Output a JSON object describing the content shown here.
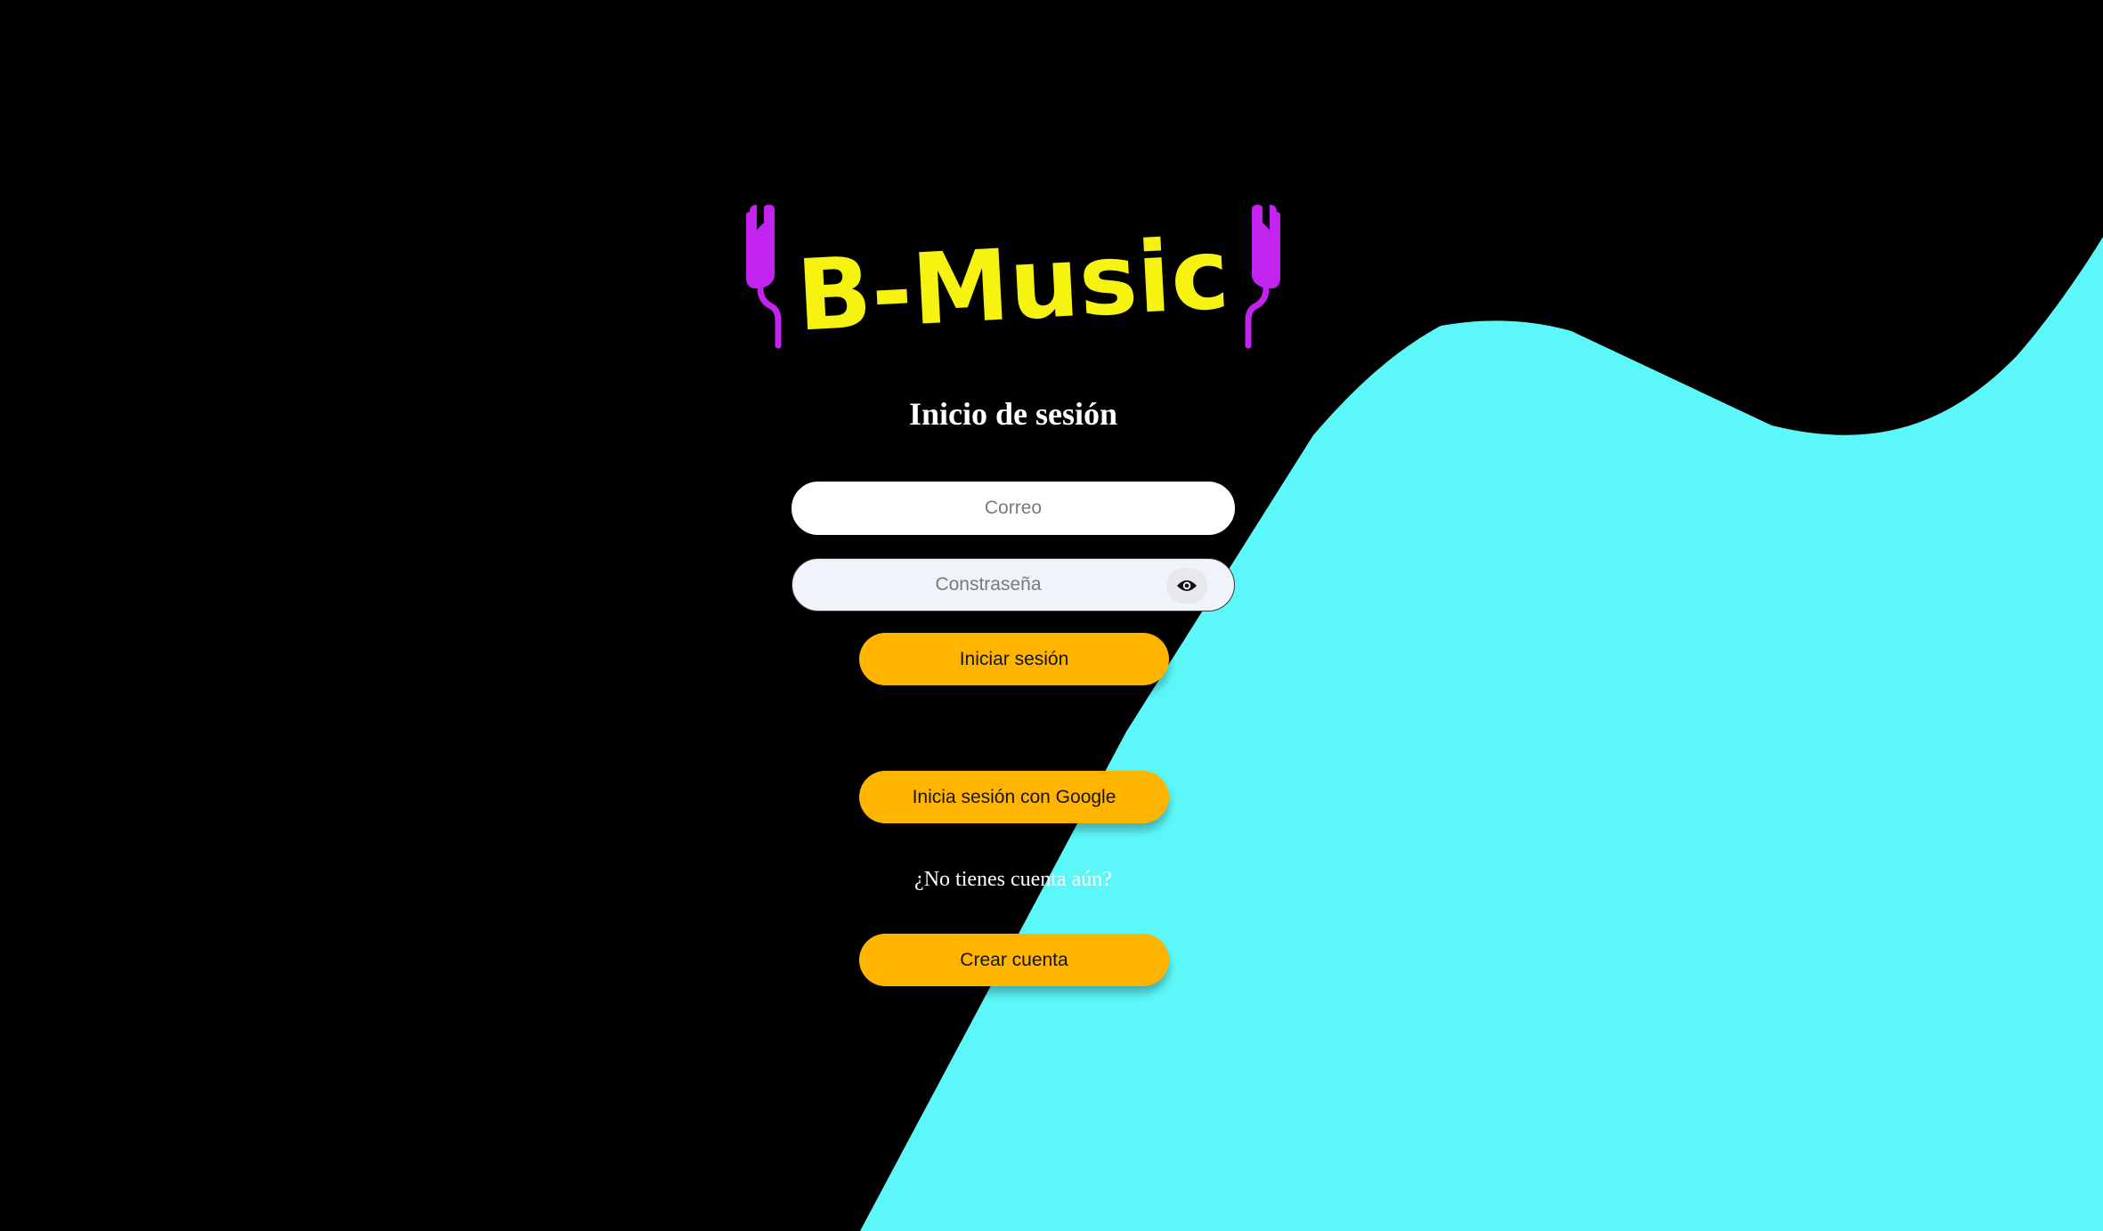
{
  "brand": {
    "name": "B-Music",
    "text_color": "#f6f311",
    "accent_color": "#c223ef",
    "icon": "earphones-icon"
  },
  "colors": {
    "background": "#000000",
    "wave": "#5cf8f9",
    "button": "#ffb400"
  },
  "login": {
    "title": "Inicio de sesión",
    "email_placeholder": "Correo",
    "password_placeholder": "Constraseña",
    "show_password_icon": "eye-icon",
    "submit_label": "Iniciar sesión",
    "google_label": "Inicia sesión con Google",
    "signup_prompt": "¿No tienes cuenta aún?",
    "create_account_label": "Crear cuenta"
  }
}
